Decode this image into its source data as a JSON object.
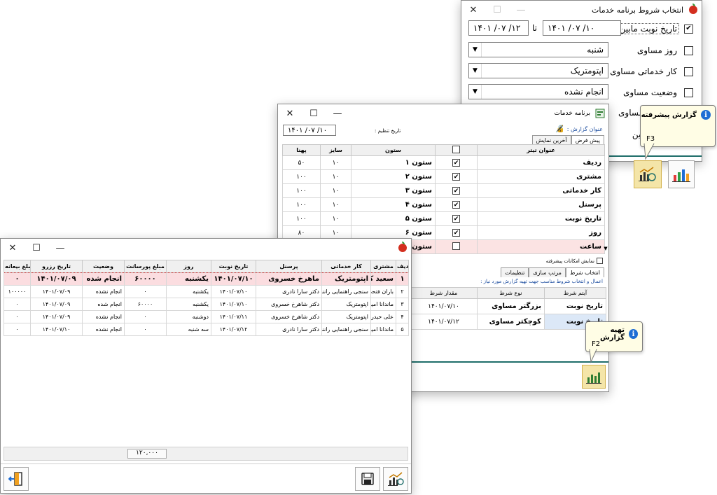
{
  "win1": {
    "title": "انتخاب شروط برنامه خدمات",
    "date_check_label": "تاریخ نوبت مابین",
    "date_from": "۱۴۰۱ /۰۷ /۱۰",
    "date_to_label": "تا",
    "date_to": "۱۴۰۱ /۰۷ /۱۲",
    "day_label": "روز مساوی",
    "day_value": "شنبه",
    "service_label": "کار خدماتی مساوی",
    "service_value": "اپتومتریک",
    "status_label": "وضعیت مساوی",
    "status_value": "انجام نشده",
    "partial_label_1": "مساوی",
    "partial_label_2": "بین"
  },
  "tip_advanced": {
    "title": "گزارش پیشرفته",
    "key": "F3"
  },
  "tip_prepare": {
    "title": "تهیه گزارش",
    "key": "F2"
  },
  "win2": {
    "title": "برنامه خدمات",
    "report_title_label": "عنوان گزارش :",
    "setting_date_label": "تاریخ تنظیم :",
    "setting_date": "۱۴۰۱ /۰۷ /۱۰",
    "tabs": [
      "پیش فرض",
      "آخرین نمایش"
    ],
    "columns_headers": {
      "title": "عنوان تیتر",
      "column": "ستون",
      "size": "سایز",
      "width": "پهنا"
    },
    "rows": [
      {
        "title": "ردیف",
        "checked": "✔",
        "column": "ستون ۱",
        "size": "۱۰",
        "width": "۵۰"
      },
      {
        "title": "مشتری",
        "checked": "✔",
        "column": "ستون ۲",
        "size": "۱۰",
        "width": "۱۰۰"
      },
      {
        "title": "کار خدماتی",
        "checked": "✔",
        "column": "ستون ۳",
        "size": "۱۰",
        "width": "۱۰۰"
      },
      {
        "title": "پرسنل",
        "checked": "✔",
        "column": "ستون ۴",
        "size": "۱۰",
        "width": "۱۰۰"
      },
      {
        "title": "تاریخ نوبت",
        "checked": "✔",
        "column": "ستون ۵",
        "size": "۱۰",
        "width": "۱۰۰"
      },
      {
        "title": "روز",
        "checked": "✔",
        "column": "ستون ۶",
        "size": "۱۰",
        "width": "۸۰"
      },
      {
        "title": "ساعت",
        "checked": "",
        "column": "ستون",
        "size": "",
        "width": ""
      }
    ],
    "advanced_label": "نمایش امکانات پیشرفته",
    "lower_tabs": [
      "انتخاب شرط",
      "مرتب سازی",
      "تنظیمات"
    ],
    "hint": "اعمال و انتخاب شروط مناسب جهت تهیه گزارش مورد نیاز :",
    "cond_headers": {
      "item": "آیتم شرط",
      "type": "نوع شرط",
      "value": "مقدار شرط"
    },
    "conditions": [
      {
        "item": "تاریخ نوبت",
        "type": "بزرگتر مساوی",
        "value": "۱۴۰۱/۰۷/۱۰"
      },
      {
        "item": "تاریخ نوبت",
        "type": "کوچکتر مساوی",
        "value": "۱۴۰۱/۰۷/۱۲"
      }
    ]
  },
  "win3": {
    "headers": [
      "ردیف",
      "مشتری",
      "کار خدماتی",
      "پرسنل",
      "تاریخ نوبت",
      "روز",
      "مبلغ پورسانت",
      "وضعیت",
      "تاریخ رزرو",
      "مبلغ بیعانه"
    ],
    "rows": [
      {
        "n": "۱",
        "customer": "سعید کرمی",
        "service": "اپتومتریک",
        "staff": "ماهرخ خسروی",
        "date": "۱۴۰۱/۰۷/۱۰",
        "day": "یکشنبه",
        "commission": "۶۰۰۰۰",
        "status": "انجام شده",
        "reserve": "۱۴۰۱/۰۷/۰۹",
        "deposit": "۰"
      },
      {
        "n": "۲",
        "customer": "باران فتحی",
        "service": "سنجی راهنمایی رانندگی",
        "staff": "دکتر سارا نادری",
        "date": "۱۴۰۱/۰۷/۱۰",
        "day": "یکشنبه",
        "commission": "۰",
        "status": "انجام نشده",
        "reserve": "۱۴۰۱/۰۷/۰۹",
        "deposit": "۱۰۰۰۰۰"
      },
      {
        "n": "۳",
        "customer": "ماندانا امیری",
        "service": "اپتومتریک",
        "staff": "دکتر شاهرخ خسروی",
        "date": "۱۴۰۱/۰۷/۱۰",
        "day": "یکشنبه",
        "commission": "۶۰۰۰۰",
        "status": "انجام شده",
        "reserve": "۱۴۰۱/۰۷/۰۹",
        "deposit": "۰"
      },
      {
        "n": "۴",
        "customer": "علی حیدرلو",
        "service": "اپتومتریک",
        "staff": "دکتر شاهرخ خسروی",
        "date": "۱۴۰۱/۰۷/۱۱",
        "day": "دوشنبه",
        "commission": "۰",
        "status": "انجام نشده",
        "reserve": "۱۴۰۱/۰۷/۰۹",
        "deposit": "۰"
      },
      {
        "n": "۵",
        "customer": "ماندانا امیری",
        "service": "سنجی راهنمایی رانندگی",
        "staff": "دکتر سارا نادری",
        "date": "۱۴۰۱/۰۷/۱۲",
        "day": "سه شنبه",
        "commission": "۰",
        "status": "انجام نشده",
        "reserve": "۱۴۰۱/۰۷/۱۰",
        "deposit": "۰"
      }
    ],
    "total": "۱۲۰,۰۰۰"
  }
}
